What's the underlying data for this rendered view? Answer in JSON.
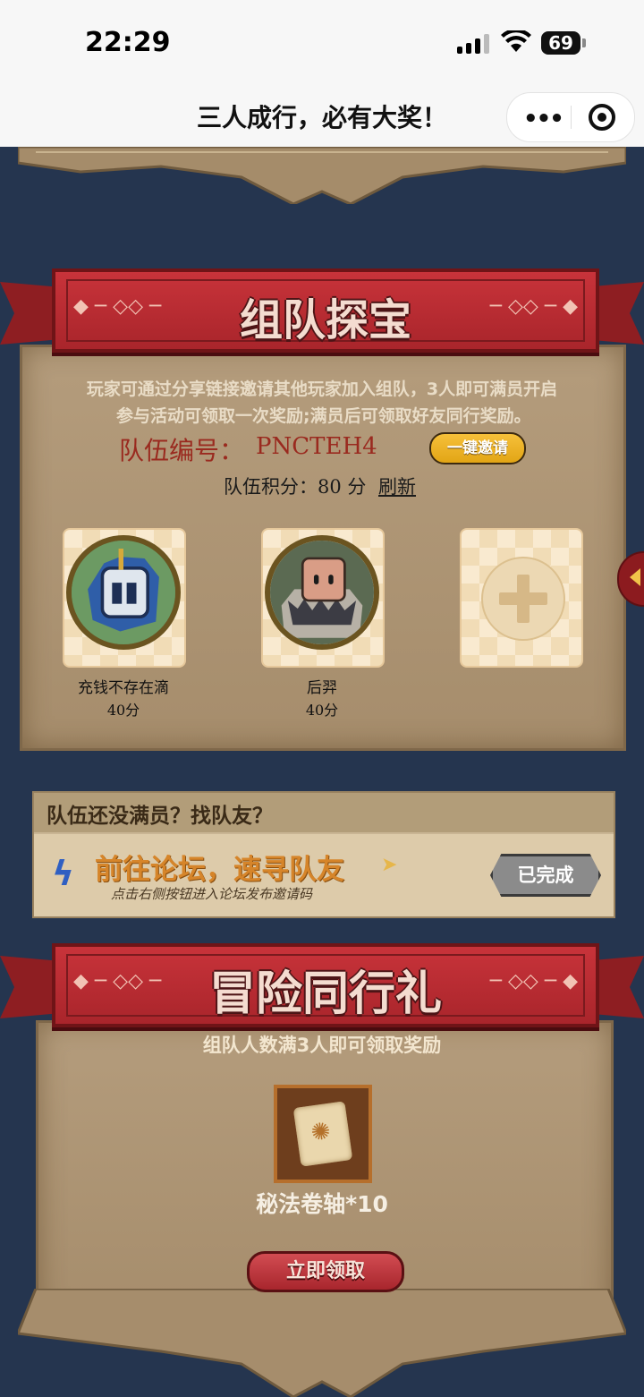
{
  "status_bar": {
    "time": "22:29",
    "battery": "69"
  },
  "nav": {
    "title": "三人成行，必有大奖！"
  },
  "team_section": {
    "banner": "组队探宝",
    "desc_line1": "玩家可通过分享链接邀请其他玩家加入组队，3人即可满员开启",
    "desc_line2": "参与活动可领取一次奖励;满员后可领取好友同行奖励。",
    "team_id_label": "队伍编号：",
    "team_id": "PNCTEH4",
    "invite_btn": "一键邀请",
    "score_label": "队伍积分：80 分",
    "refresh": "刷新",
    "members": [
      {
        "name": "充钱不存在滴",
        "score": "40分"
      },
      {
        "name": "后羿",
        "score": "40分"
      }
    ]
  },
  "forum_section": {
    "heading": "队伍还没满员？找队友？",
    "title": "前往论坛，速寻队友",
    "subtitle": "点击右侧按钮进入论坛发布邀请码",
    "button": "已完成"
  },
  "reward_section": {
    "banner": "冒险同行礼",
    "condition": "组队人数满3人即可领取奖励",
    "item_name": "秘法卷轴*10",
    "claim_btn": "立即领取"
  },
  "colors": {
    "background": "#25354f",
    "ribbon": "#b62b31",
    "parchment": "#a68d6c",
    "accent_gold": "#f1c03a"
  }
}
